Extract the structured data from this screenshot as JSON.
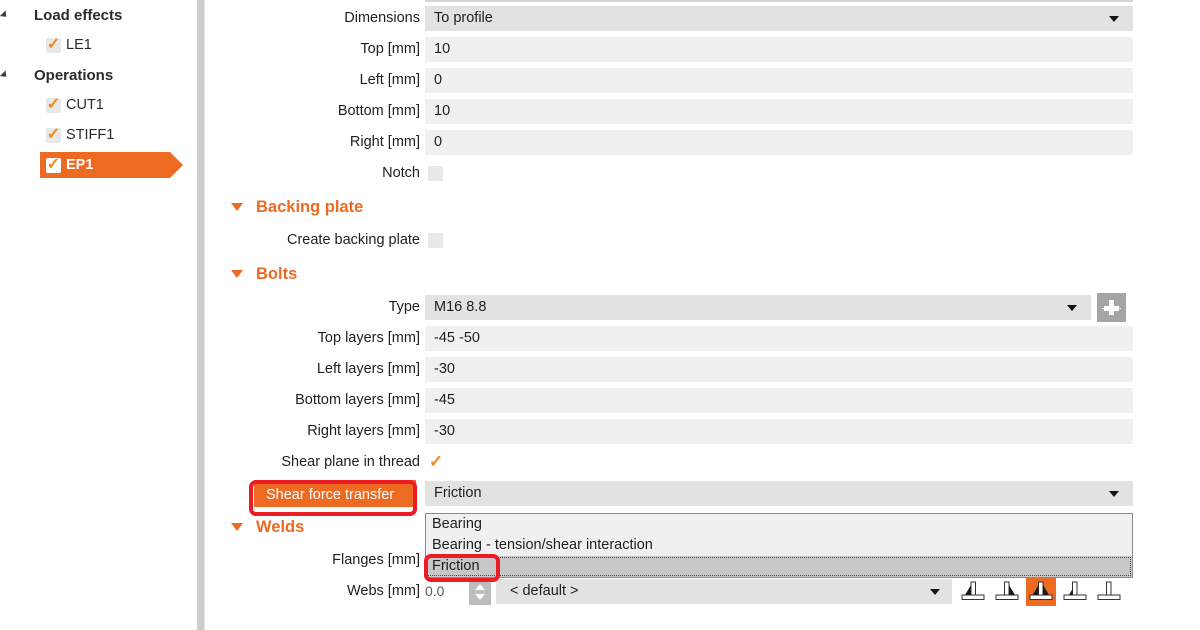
{
  "tree": {
    "groups": [
      {
        "label": "Load effects",
        "expander": "expander-triangle",
        "items": [
          {
            "label": "LE1",
            "checked": true,
            "selected": false
          }
        ]
      },
      {
        "label": "Operations",
        "expander": "expander-triangle",
        "items": [
          {
            "label": "CUT1",
            "checked": true,
            "selected": false
          },
          {
            "label": "STIFF1",
            "checked": true,
            "selected": false
          },
          {
            "label": "EP1",
            "checked": true,
            "selected": true
          }
        ]
      }
    ]
  },
  "form": {
    "rows_top": [
      {
        "label": "Dimensions",
        "value": "To profile",
        "type": "combo"
      },
      {
        "label": "Top [mm]",
        "value": "10",
        "type": "text"
      },
      {
        "label": "Left [mm]",
        "value": "0",
        "type": "text"
      },
      {
        "label": "Bottom [mm]",
        "value": "10",
        "type": "text"
      },
      {
        "label": "Right [mm]",
        "value": "0",
        "type": "text"
      },
      {
        "label": "Notch",
        "value": "",
        "type": "checkbox",
        "checked": false
      }
    ],
    "backing_plate": {
      "title": "Backing plate",
      "rows": [
        {
          "label": "Create backing plate",
          "value": "",
          "type": "checkbox",
          "checked": false
        }
      ]
    },
    "bolts": {
      "title": "Bolts",
      "rows": [
        {
          "label": "Type",
          "value": "M16 8.8",
          "type": "combo-plus"
        },
        {
          "label": "Top layers [mm]",
          "value": "-45 -50",
          "type": "text"
        },
        {
          "label": "Left layers [mm]",
          "value": "-30",
          "type": "text"
        },
        {
          "label": "Bottom layers [mm]",
          "value": "-45",
          "type": "text"
        },
        {
          "label": "Right layers [mm]",
          "value": "-30",
          "type": "text"
        },
        {
          "label": "Shear plane in thread",
          "value": "",
          "type": "checkmark",
          "checked": true
        }
      ],
      "shear_force_transfer": {
        "label": "Shear force transfer",
        "value": "Friction",
        "highlighted": true,
        "options": [
          "Bearing",
          "Bearing - tension/shear interaction",
          "Friction"
        ],
        "selected_option": "Friction"
      }
    },
    "welds": {
      "title": "Welds",
      "rows": [
        {
          "label": "Flanges [mm]",
          "value": "",
          "type": "hidden"
        }
      ],
      "webs": {
        "label": "Webs [mm]",
        "value": "0.0",
        "default_label": "< default >",
        "weld_icons": [
          {
            "name": "weld-left-fillet-icon",
            "active": false
          },
          {
            "name": "weld-right-fillet-icon",
            "active": false
          },
          {
            "name": "weld-double-fillet-icon",
            "active": true
          },
          {
            "name": "weld-partial-penetration-icon",
            "active": false
          },
          {
            "name": "weld-none-icon",
            "active": false
          }
        ]
      }
    }
  },
  "colors": {
    "accent": "#ED6A23",
    "annotation": "#ED1C24",
    "field": "#f0f0f0",
    "combo": "#e2e2e2"
  }
}
